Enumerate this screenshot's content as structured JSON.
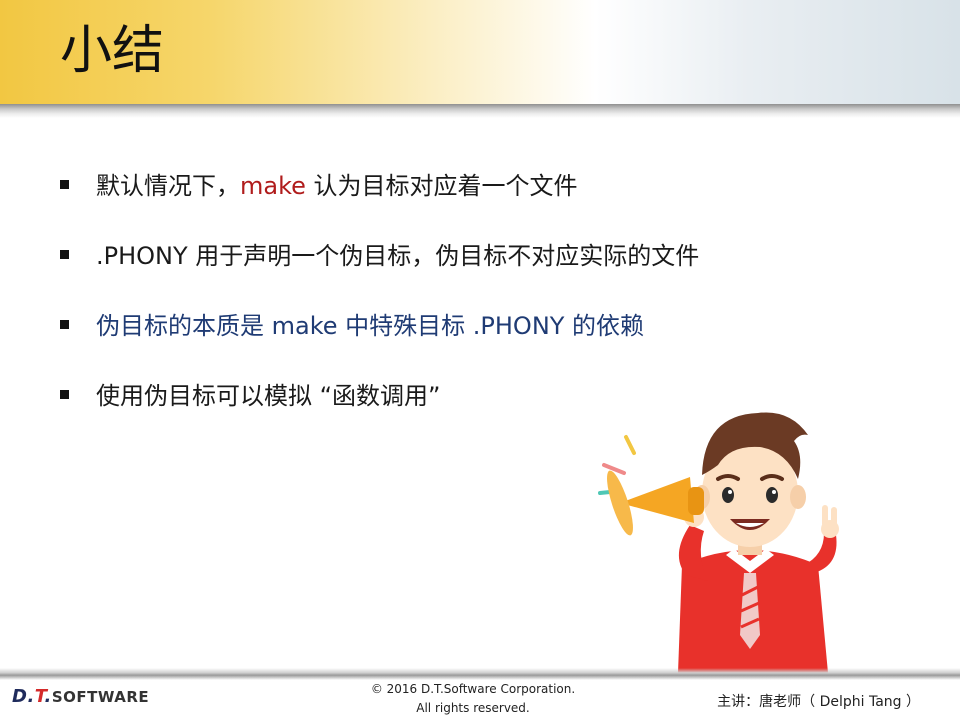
{
  "slide": {
    "title": "小结",
    "bullets": [
      {
        "parts": [
          {
            "text": "默认情况下，",
            "color": "default"
          },
          {
            "text": "make",
            "color": "red"
          },
          {
            "text": " 认为目标对应着一个文件",
            "color": "default"
          }
        ]
      },
      {
        "parts": [
          {
            "text": ".PHONY 用于声明一个伪目标，伪目标不对应实际的文件",
            "color": "default"
          }
        ]
      },
      {
        "parts": [
          {
            "text": "伪目标的本质是 make 中特殊目标 .PHONY 的依赖",
            "color": "navy"
          }
        ]
      },
      {
        "parts": [
          {
            "text": "使用伪目标可以模拟 “函数调用”",
            "color": "default"
          }
        ]
      }
    ]
  },
  "footer": {
    "logo_d": "D.",
    "logo_t": "T",
    "logo_rest": ".",
    "logo_software": "SOFTWARE",
    "copyright_line1": "© 2016 D.T.Software Corporation.",
    "copyright_line2": "All rights reserved.",
    "presenter": "主讲：唐老师（ Delphi Tang ）"
  },
  "colors": {
    "accent_red": "#b01c1c",
    "navy": "#1f3b74",
    "header_gold": "#f2c742"
  },
  "icons": {
    "illustration": "cartoon-man-with-megaphone"
  }
}
